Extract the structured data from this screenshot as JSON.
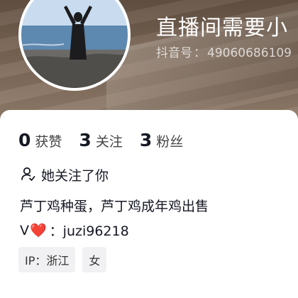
{
  "profile": {
    "nickname": "直播间需要小",
    "id_label": "抖音号",
    "id_value": "49060686109",
    "id_separator": "："
  },
  "stats": [
    {
      "value": "0",
      "label": "获赞"
    },
    {
      "value": "3",
      "label": "关注"
    },
    {
      "value": "3",
      "label": "粉丝"
    }
  ],
  "follow_status": "她关注了你",
  "bio": {
    "line1": "芦丁鸡种蛋，芦丁鸡成年鸡出售",
    "line2_prefix": "V",
    "line2_heart": "❤️",
    "line2_suffix": "：juzi96218"
  },
  "tags": [
    "IP：浙江",
    "女"
  ],
  "colors": {
    "text_primary": "#161823",
    "heart": "#e02929",
    "tag_bg": "#f1f1f3"
  }
}
